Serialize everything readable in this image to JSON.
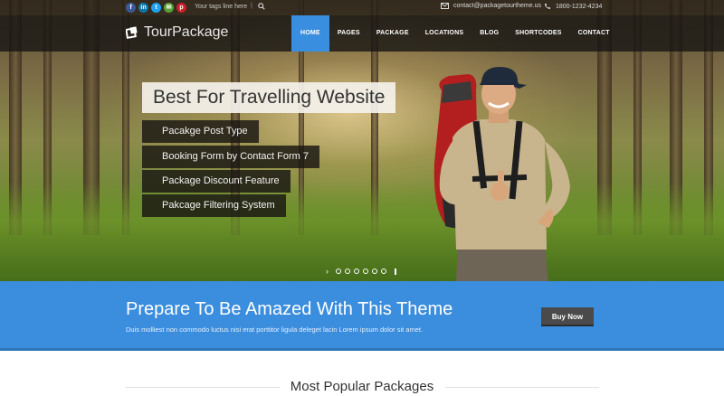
{
  "topbar": {
    "social": [
      {
        "name": "facebook-icon",
        "glyph": "f",
        "color": "#3b5998"
      },
      {
        "name": "linkedin-icon",
        "glyph": "in",
        "color": "#0e76a8"
      },
      {
        "name": "twitter-icon",
        "glyph": "t",
        "color": "#1da1f2"
      },
      {
        "name": "email-icon",
        "glyph": "✉",
        "color": "#5aa13a"
      },
      {
        "name": "pinterest-icon",
        "glyph": "p",
        "color": "#cb2027"
      }
    ],
    "search_placeholder": "Your tags line here",
    "separator": "|",
    "email": "contact@packagetourtheme.us",
    "phone": "1800-1232-4234"
  },
  "logo": {
    "text": "TourPackage"
  },
  "nav": {
    "items": [
      "HOME",
      "PAGES",
      "PACKAGE",
      "LOCATIONS",
      "BLOG",
      "SHORTCODES",
      "CONTACT"
    ],
    "active_index": 0,
    "accent": "#3a8ee0"
  },
  "slider": {
    "headline": "Best For Travelling Website",
    "features": [
      "Pacakge Post Type",
      "Booking Form by Contact Form 7",
      "Package Discount Feature",
      "Pakcage Filtering System"
    ],
    "dots": 6,
    "active_dot": 0
  },
  "cta": {
    "title": "Prepare To Be Amazed With This Theme",
    "text": "Duis molliest non commodo luctus nisi erat porttitor ligula deleget lacin Lorem ipsum dolor sit amet.",
    "button": "Buy Now",
    "color": "#3b8ddd"
  },
  "section": {
    "title": "Most Popular Packages"
  }
}
